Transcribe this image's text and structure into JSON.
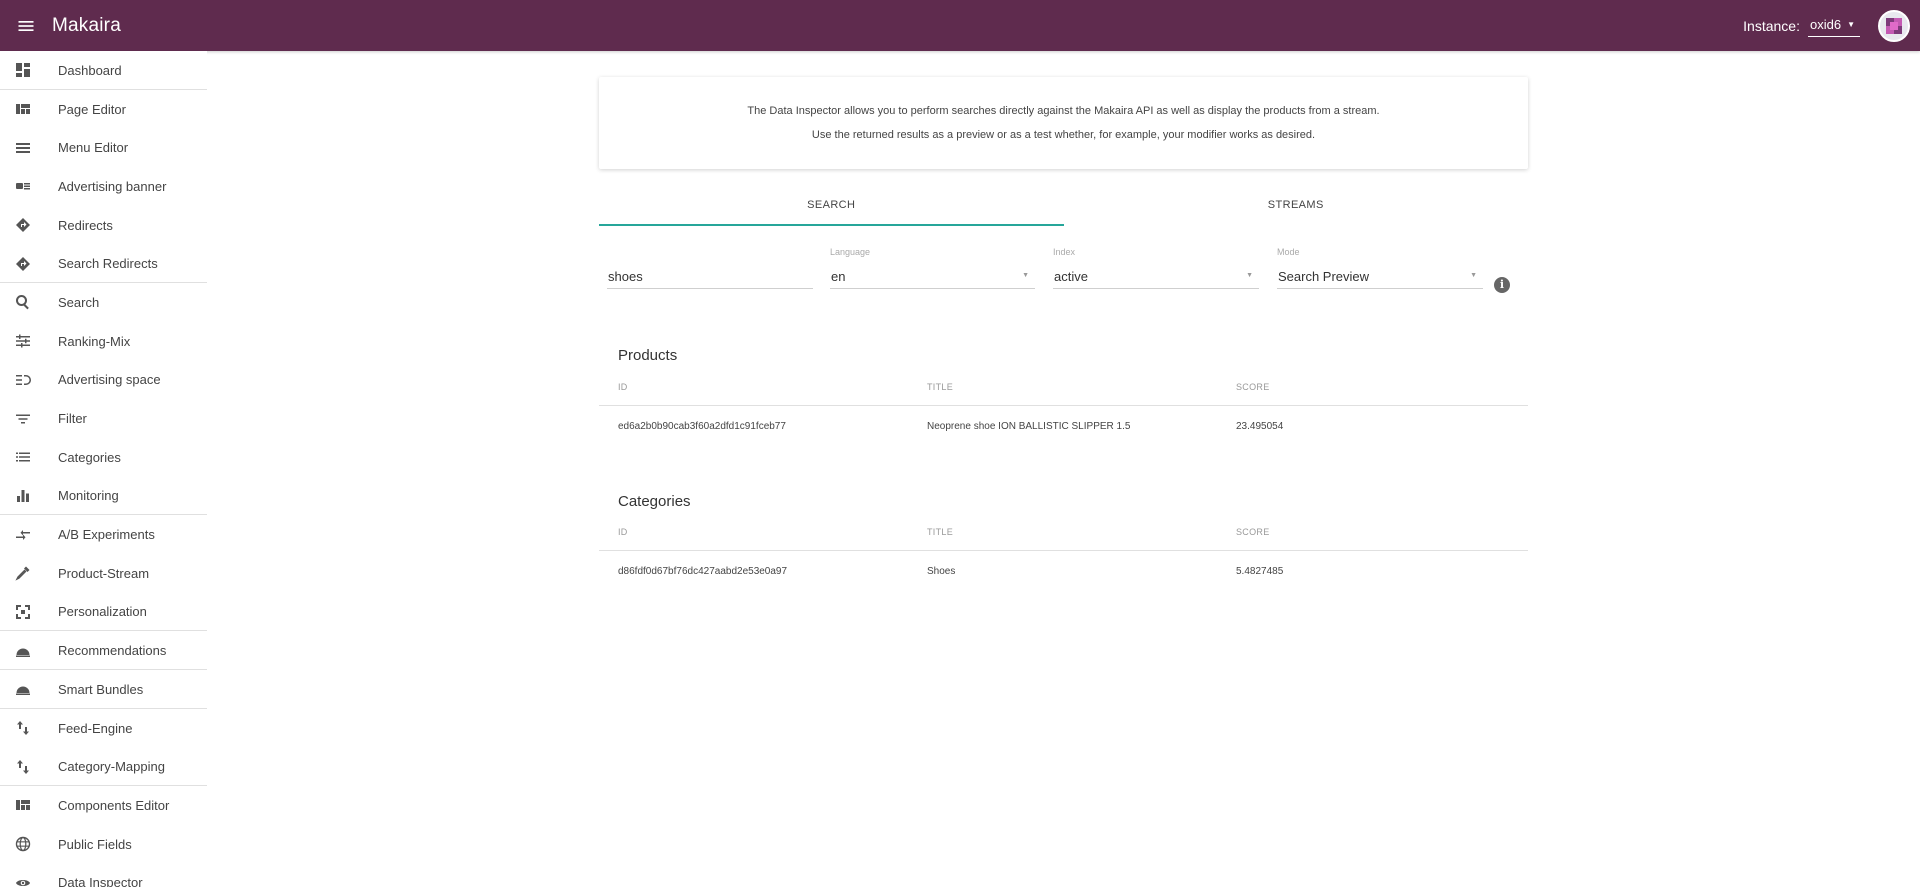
{
  "app": {
    "title": "Makaira"
  },
  "topbar": {
    "instance_label": "Instance:",
    "instance_value": "oxid6"
  },
  "sidebar": {
    "items": [
      {
        "label": "Dashboard"
      },
      {
        "label": "Page Editor"
      },
      {
        "label": "Menu Editor"
      },
      {
        "label": "Advertising banner"
      },
      {
        "label": "Redirects"
      },
      {
        "label": "Search Redirects"
      },
      {
        "label": "Search"
      },
      {
        "label": "Ranking-Mix"
      },
      {
        "label": "Advertising space"
      },
      {
        "label": "Filter"
      },
      {
        "label": "Categories"
      },
      {
        "label": "Monitoring"
      },
      {
        "label": "A/B Experiments"
      },
      {
        "label": "Product-Stream"
      },
      {
        "label": "Personalization"
      },
      {
        "label": "Recommendations"
      },
      {
        "label": "Smart Bundles"
      },
      {
        "label": "Feed-Engine"
      },
      {
        "label": "Category-Mapping"
      },
      {
        "label": "Components Editor"
      },
      {
        "label": "Public Fields"
      },
      {
        "label": "Data Inspector"
      }
    ]
  },
  "info": {
    "line1": "The Data Inspector allows you to perform searches directly against the Makaira API as well as display the products from a stream.",
    "line2": "Use the returned results as a preview or as a test whether, for example, your modifier works as desired."
  },
  "tabs": [
    {
      "label": "SEARCH"
    },
    {
      "label": "STREAMS"
    }
  ],
  "form": {
    "query": "shoes",
    "language": {
      "label": "Language",
      "value": "en"
    },
    "index": {
      "label": "Index",
      "value": "active"
    },
    "mode": {
      "label": "Mode",
      "value": "Search Preview"
    }
  },
  "products": {
    "title": "Products",
    "headers": {
      "id": "ID",
      "title": "TITLE",
      "score": "SCORE"
    },
    "rows": [
      {
        "id": "ed6a2b0b90cab3f60a2dfd1c91fceb77",
        "title": "Neoprene shoe ION BALLISTIC SLIPPER 1.5",
        "score": "23.495054"
      }
    ]
  },
  "categories": {
    "title": "Categories",
    "headers": {
      "id": "ID",
      "title": "TITLE",
      "score": "SCORE"
    },
    "rows": [
      {
        "id": "d86fdf0d67bf76dc427aabd2e53e0a97",
        "title": "Shoes",
        "score": "5.4827485"
      }
    ]
  },
  "colors": {
    "topbar": "#5f2b4e",
    "accent": "#26a69a"
  }
}
